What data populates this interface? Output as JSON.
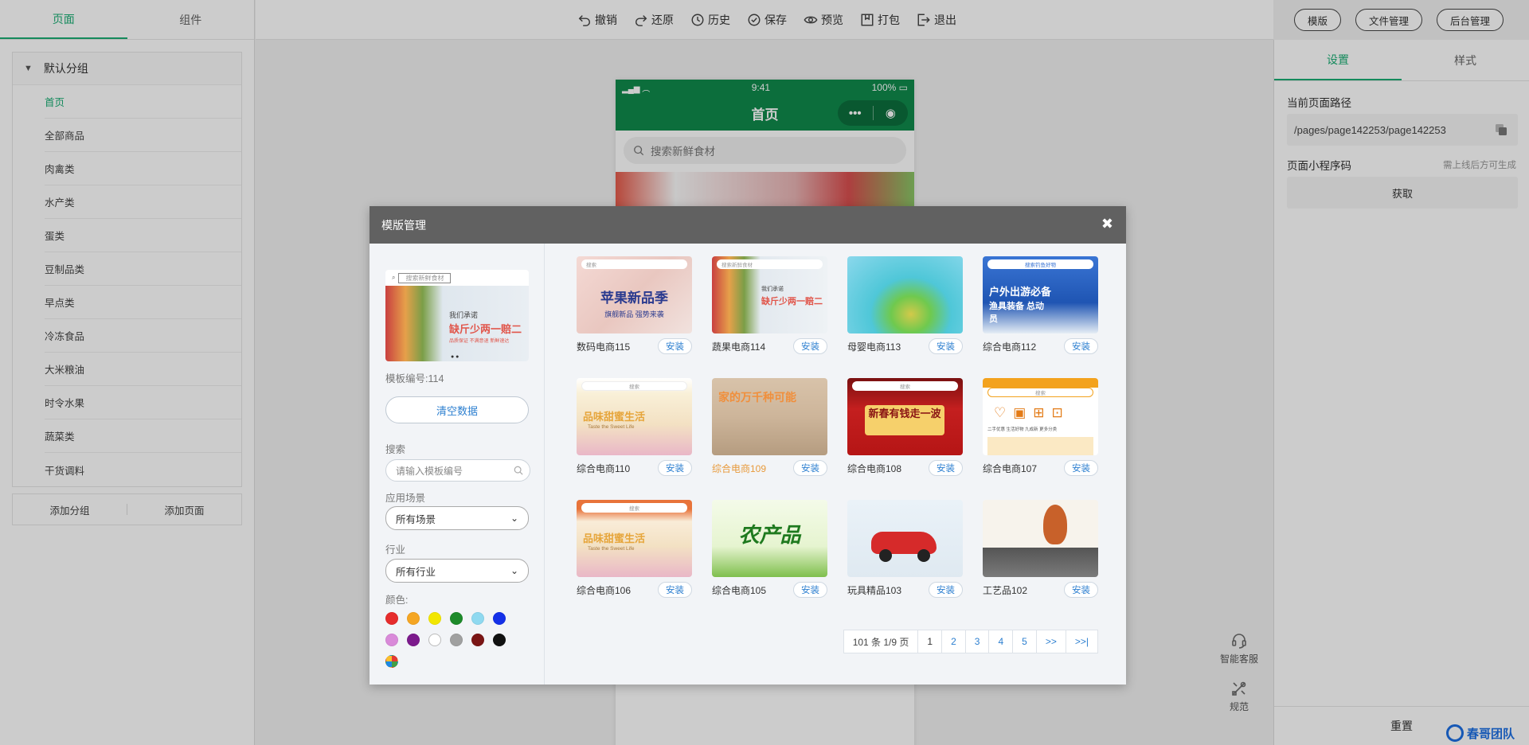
{
  "left": {
    "tabs": [
      "页面",
      "组件"
    ],
    "group_title": "默认分组",
    "pages": [
      "首页",
      "全部商品",
      "肉禽类",
      "水产类",
      "蛋类",
      "豆制品类",
      "早点类",
      "冷冻食品",
      "大米粮油",
      "时令水果",
      "蔬菜类",
      "干货调料"
    ],
    "add_group": "添加分组",
    "add_page": "添加页面"
  },
  "toolbar": {
    "undo": "撤销",
    "redo": "还原",
    "history": "历史",
    "save": "保存",
    "preview": "预览",
    "pack": "打包",
    "exit": "退出",
    "template": "模版",
    "file_manage": "文件管理",
    "admin": "后台管理"
  },
  "phone": {
    "time": "9:41",
    "battery": "100%",
    "title": "首页",
    "search_placeholder": "搜索新鲜食材"
  },
  "right": {
    "tabs": [
      "设置",
      "样式"
    ],
    "path_label": "当前页面路径",
    "path_value": "/pages/page142253/page142253",
    "qrcode_label": "页面小程序码",
    "qrcode_hint": "需上线后方可生成",
    "get_button": "获取",
    "reset": "重置",
    "brand": "春哥团队"
  },
  "float": {
    "service": "智能客服",
    "spec": "规范"
  },
  "modal": {
    "title": "模版管理",
    "preview_search": "搜索新鲜食材",
    "preview_line1": "我们承诺",
    "preview_line2": "缺斤少两一赔二",
    "preview_line3": "品质保证    不满意退    新鲜速达",
    "template_no": "模板编号:114",
    "clear_data": "清空数据",
    "search_label": "搜索",
    "search_placeholder": "请输入模板编号",
    "scene_label": "应用场景",
    "scene_value": "所有场景",
    "industry_label": "行业",
    "industry_value": "所有行业",
    "color_label": "颜色:",
    "colors": [
      "#e62c2c",
      "#f5a623",
      "#f2e600",
      "#1d8a2a",
      "#8fd9f0",
      "#1430e8",
      "#d98ad9",
      "#7c1a8c",
      "#ffffff",
      "#a0a0a0",
      "#7a1515",
      "#111111"
    ],
    "install": "安装",
    "templates": [
      {
        "name": "数码电商115",
        "thumb_text": "苹果新品季",
        "thumb_sub": "旗舰新品    强势来袭",
        "search": "搜索"
      },
      {
        "name": "蔬果电商114",
        "thumb_text": "缺斤少两一赔二",
        "thumb_sub": "我们承诺",
        "search": "搜索新鲜食材"
      },
      {
        "name": "母婴电商113",
        "thumb_text": "",
        "thumb_sub": "",
        "search": ""
      },
      {
        "name": "综合电商112",
        "thumb_text": "户外出游必备",
        "thumb_sub": "渔具装备 总动员",
        "search": "搜索钓鱼好物"
      },
      {
        "name": "综合电商110",
        "thumb_text": "品味甜蜜生活",
        "thumb_sub": "Taste the Sweet Life",
        "search": "搜索"
      },
      {
        "name": "综合电商109",
        "thumb_text": "家的万千种可能",
        "thumb_sub": "",
        "search": ""
      },
      {
        "name": "综合电商108",
        "thumb_text": "新春有钱走一波",
        "thumb_sub": "",
        "search": "搜索"
      },
      {
        "name": "综合电商107",
        "thumb_text": "",
        "thumb_sub": "二手优惠  生活好物  九成新  更多分类",
        "search": "搜索"
      },
      {
        "name": "综合电商106",
        "thumb_text": "品味甜蜜生活",
        "thumb_sub": "Taste the Sweet Life",
        "search": "搜索"
      },
      {
        "name": "综合电商105",
        "thumb_text": "农产品",
        "thumb_sub": "",
        "search": ""
      },
      {
        "name": "玩具精品103",
        "thumb_text": "",
        "thumb_sub": "",
        "search": ""
      },
      {
        "name": "工艺品102",
        "thumb_text": "",
        "thumb_sub": "",
        "search": ""
      }
    ],
    "pager": {
      "summary": "101 条 1/9 页",
      "pages": [
        "1",
        "2",
        "3",
        "4",
        "5"
      ],
      "next": ">>",
      "last": ">>|"
    }
  }
}
